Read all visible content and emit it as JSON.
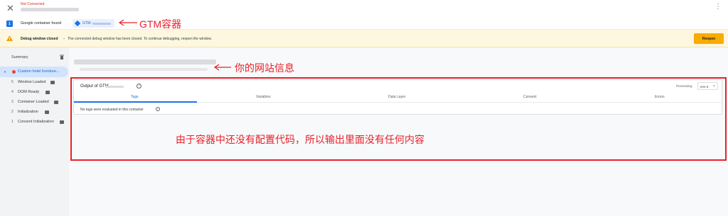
{
  "topbar": {
    "status": "Not Connected",
    "close_icon": "close-icon",
    "menu_icon": "more-vert-icon"
  },
  "container_row": {
    "badge": "1",
    "found_label": "Google container found",
    "chip_label": "GTM-",
    "annotation": "GTM容器"
  },
  "banner": {
    "title": "Debug window closed",
    "chevron": "⌄",
    "message": "The connected debug window has been closed. To continue debugging, reopen the window.",
    "reopen_label": "Reopen",
    "accent": "#f9ab00"
  },
  "sidebar": {
    "title": "Summary",
    "active_event": "Custom hotel furniture...",
    "events": [
      {
        "num": "5",
        "label": "Window Loaded"
      },
      {
        "num": "4",
        "label": "DOM Ready"
      },
      {
        "num": "3",
        "label": "Container Loaded"
      },
      {
        "num": "2",
        "label": "Initialization"
      },
      {
        "num": "1",
        "label": "Consent Initialization"
      }
    ]
  },
  "main": {
    "site_annotation": "你的网站信息",
    "output_title": "Output of GTM-",
    "previewing_label": "Previewing:",
    "env_label": "env-3",
    "env_close": "×",
    "tabs": [
      "Tags",
      "Variables",
      "Data Layer",
      "Consent",
      "Errors"
    ],
    "empty_message": "No tags were evaluated in this container",
    "box_annotation": "由于容器中还没有配置代码，所以输出里面没有任何内容",
    "annotation_color": "#e8202a"
  }
}
